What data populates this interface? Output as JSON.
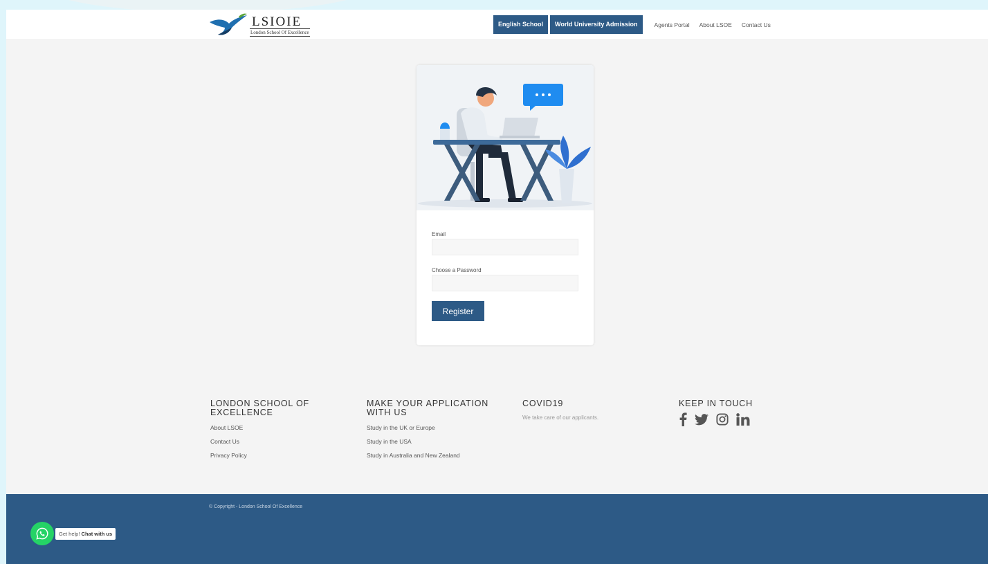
{
  "header": {
    "logo": {
      "title": "LSIOIE",
      "subtitle": "London School Of Excellence"
    },
    "nav": {
      "buttons": [
        "English School",
        "World University Admission"
      ],
      "links": [
        "Agents Portal",
        "About LSOE",
        "Contact Us"
      ]
    }
  },
  "form": {
    "email_label": "Email",
    "email_value": "",
    "password_label": "Choose a Password",
    "password_value": "",
    "register_label": "Register"
  },
  "footer": {
    "col1": {
      "heading": "London School of Excellence",
      "links": [
        "About LSOE",
        "Contact Us",
        "Privacy Policy"
      ]
    },
    "col2": {
      "heading": "Make your application with us",
      "links": [
        "Study in the UK or Europe",
        "Study in the USA",
        "Study in Australia and New Zealand"
      ]
    },
    "col3": {
      "heading": "COVID19",
      "text": "We take care of our applicants."
    },
    "col4": {
      "heading": "Keep in touch",
      "social": [
        "facebook-icon",
        "twitter-icon",
        "instagram-icon",
        "linkedin-icon"
      ]
    },
    "copyright": "© Copyright - London School Of Excellence"
  },
  "chat": {
    "prefix": "Get help!",
    "label": "Chat with us"
  },
  "colors": {
    "brand": "#2d5a86",
    "whatsapp": "#25d366",
    "page_bg": "#f4f4f4"
  }
}
